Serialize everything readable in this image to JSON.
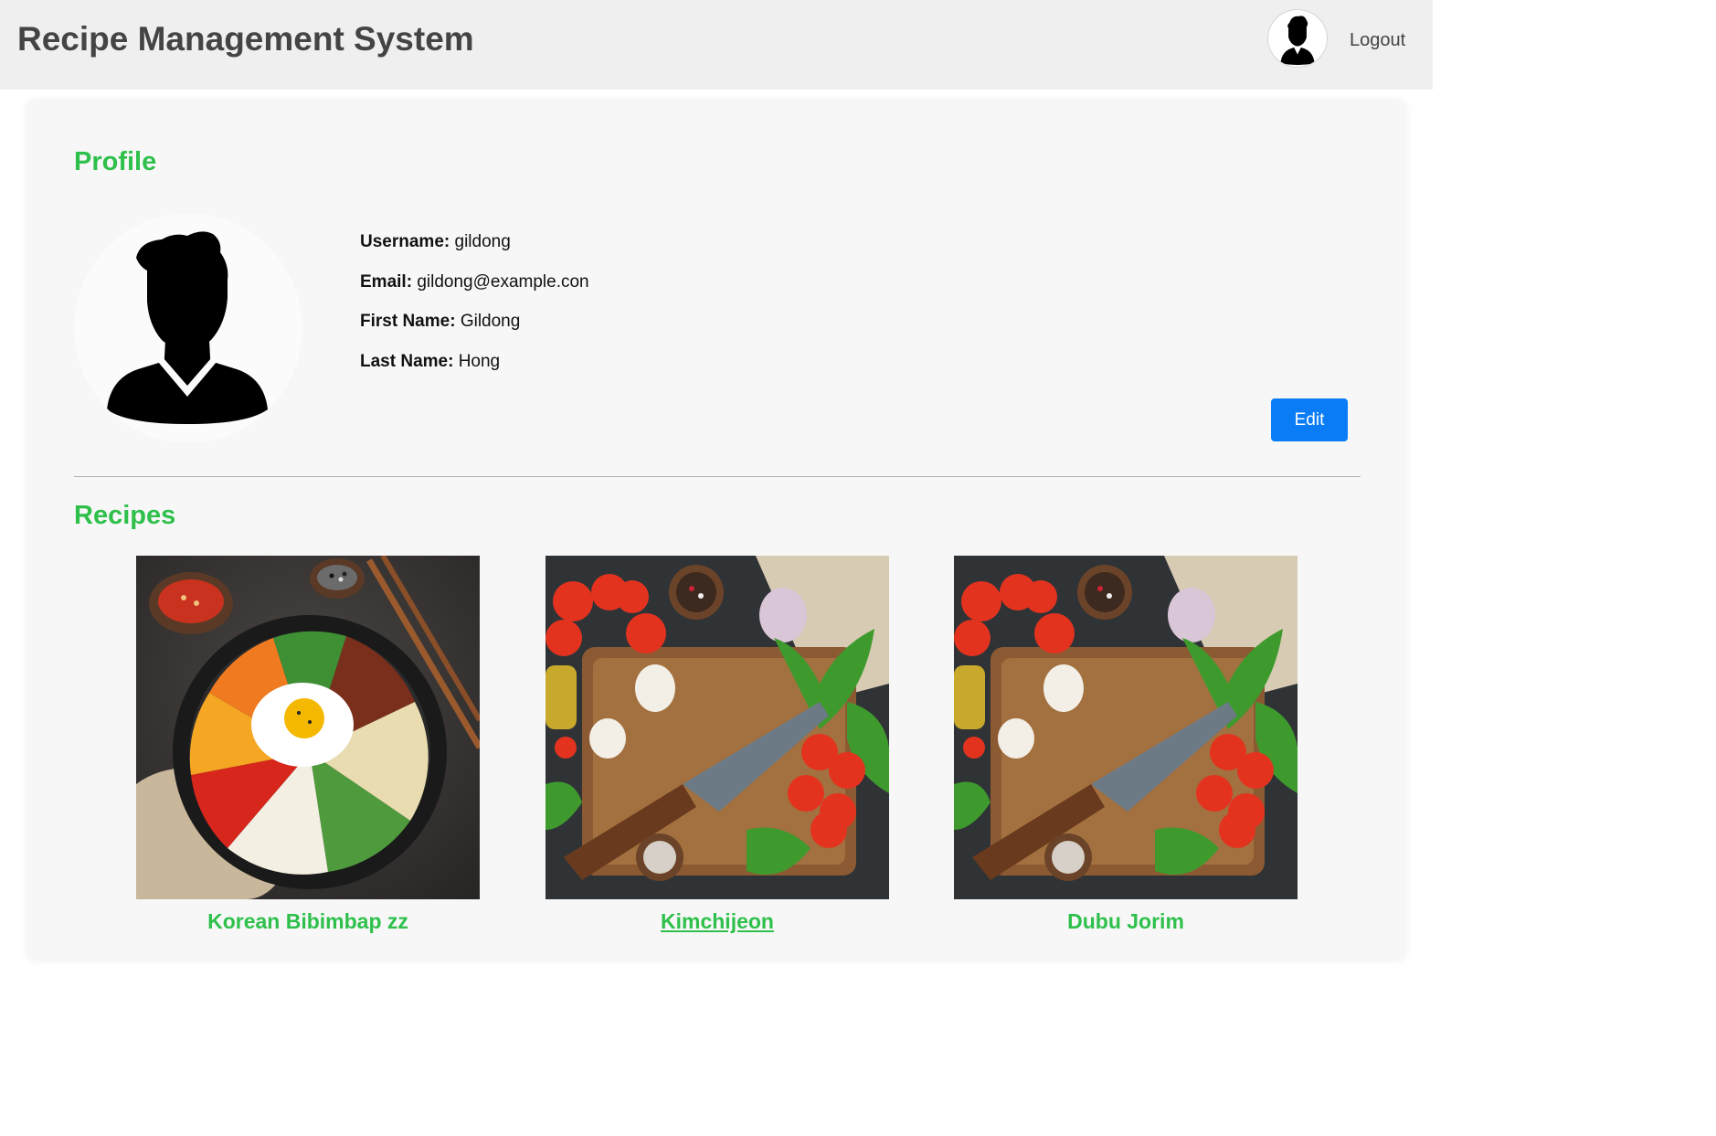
{
  "header": {
    "app_title": "Recipe Management System",
    "logout_label": "Logout",
    "avatar_icon": "user-silhouette-icon"
  },
  "profile": {
    "section_title": "Profile",
    "avatar_icon": "user-silhouette-icon",
    "fields": [
      {
        "label": "Username:",
        "value": "gildong"
      },
      {
        "label": "Email:",
        "value": "gildong@example.con"
      },
      {
        "label": "First Name:",
        "value": "Gildong"
      },
      {
        "label": "Last Name:",
        "value": "Hong"
      }
    ],
    "edit_label": "Edit"
  },
  "recipes": {
    "section_title": "Recipes",
    "items": [
      {
        "name": "Korean Bibimbap zz",
        "image": "bibimbap-photo",
        "hovered": false
      },
      {
        "name": "Kimchijeon",
        "image": "cutting-board-tomatoes-photo",
        "hovered": true
      },
      {
        "name": "Dubu Jorim",
        "image": "cutting-board-tomatoes-photo",
        "hovered": false
      }
    ]
  },
  "colors": {
    "accent_green": "#2ec04b",
    "button_blue": "#0a7cf5",
    "header_bg": "#efefef",
    "card_bg": "#f7f7f7"
  }
}
